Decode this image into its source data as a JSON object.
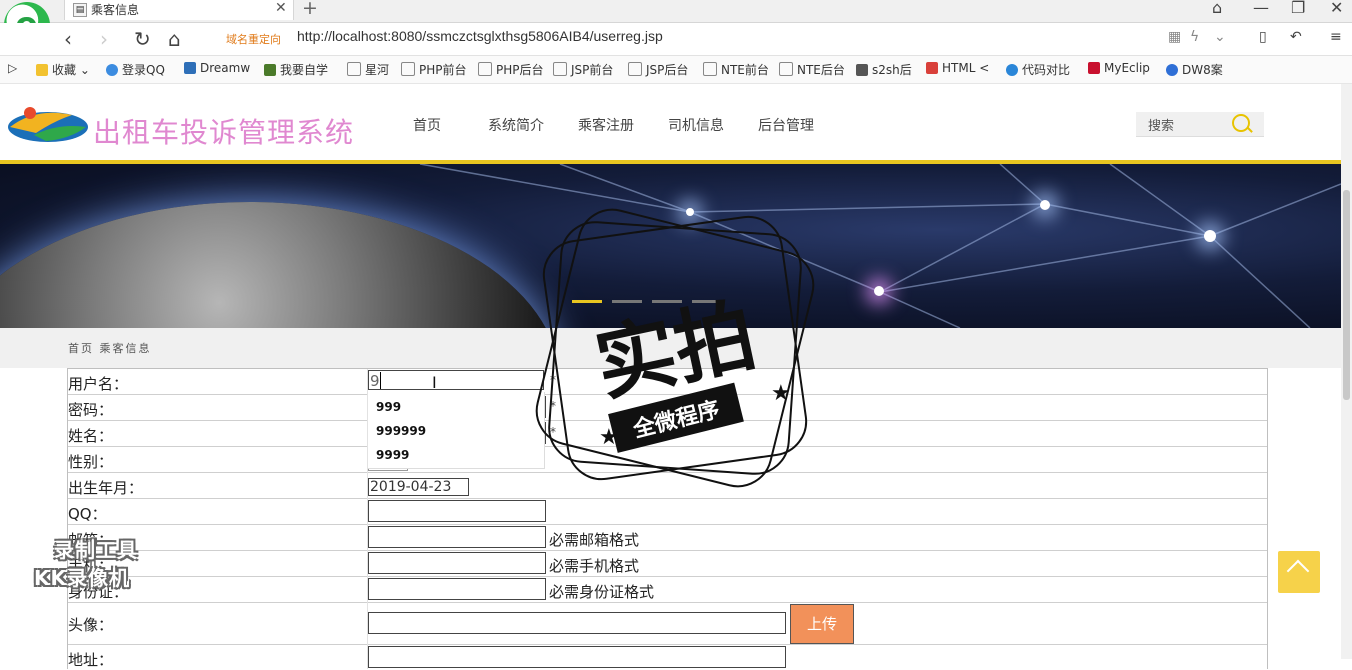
{
  "browser": {
    "tab_title": "乘客信息",
    "redirect_label": "域名重定向",
    "url": "http://localhost:8080/ssmczctsglxthsg5806AIB4/userreg.jsp",
    "bookmarks": [
      "收藏",
      "登录QQ",
      "Dreamw",
      "我要自学",
      "星河",
      "PHP前台",
      "PHP后台",
      "JSP前台",
      "JSP后台",
      "NTE前台",
      "NTE后台",
      "s2sh后",
      "HTML <",
      "代码对比",
      "MyEclip",
      "DW8案"
    ]
  },
  "header": {
    "site_title": "出租车投诉管理系统",
    "nav": [
      "首页",
      "系统简介",
      "乘客注册",
      "司机信息",
      "后台管理"
    ],
    "search_placeholder": "搜索"
  },
  "breadcrumb": "首页 乘客信息",
  "form": {
    "labels": {
      "username": "用户名：",
      "password": "密码：",
      "name": "姓名：",
      "gender": "性别：",
      "birthday": "出生年月：",
      "qq": "QQ：",
      "email": "邮箱：",
      "phone": "手机：",
      "idcard": "身份证：",
      "avatar": "头像：",
      "address": "地址："
    },
    "username_value": "9",
    "birthday_value": "2019-04-23",
    "required_mark": "*",
    "hints": {
      "email": "必需邮箱格式",
      "phone": "必需手机格式",
      "idcard": "必需身份证格式"
    },
    "upload_label": "上传",
    "autocomplete": [
      "999",
      "999999",
      "9999"
    ]
  },
  "overlays": {
    "stamp_main": "实拍",
    "stamp_sub": "全微程序",
    "recorder_line1": "录制工具",
    "recorder_line2": "KK录像机"
  },
  "colors": {
    "site_title": "#e088d0",
    "accent": "#e8c520",
    "upload_button": "#f2915a"
  }
}
